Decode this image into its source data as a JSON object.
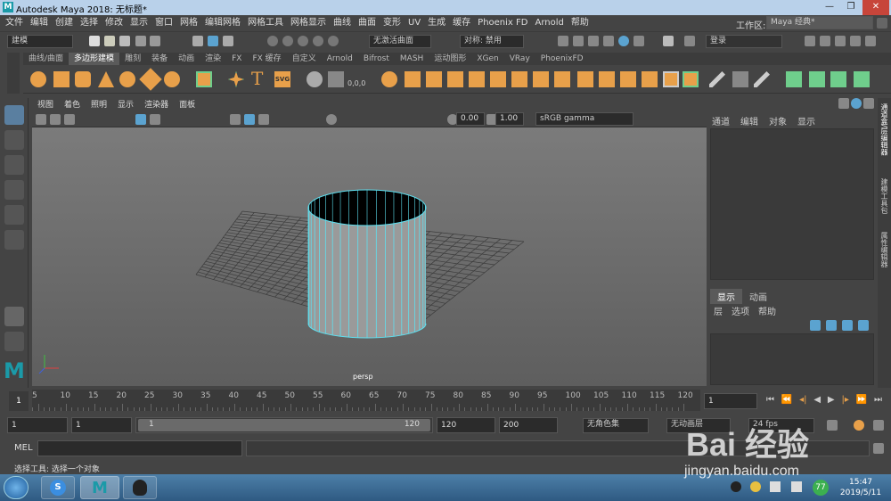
{
  "window": {
    "title": "Autodesk Maya 2018: 无标题*",
    "minimize": "—",
    "restore": "❐",
    "close": "✕"
  },
  "menu": [
    "文件",
    "编辑",
    "创建",
    "选择",
    "修改",
    "显示",
    "窗口",
    "网格",
    "编辑网格",
    "网格工具",
    "网格显示",
    "曲线",
    "曲面",
    "变形",
    "UV",
    "生成",
    "缓存",
    "Phoenix FD",
    "Arnold",
    "帮助"
  ],
  "workspace": {
    "label": "工作区:",
    "value": "Maya 经典*"
  },
  "statusline": {
    "mode": "建模",
    "live_surface": "无激活曲面",
    "symmetry": "对称: 禁用",
    "login": "登录"
  },
  "shelf_tabs": [
    "曲线/曲面",
    "多边形建模",
    "雕刻",
    "装备",
    "动画",
    "渲染",
    "FX",
    "FX 缓存",
    "自定义",
    "Arnold",
    "Bifrost",
    "MASH",
    "运动图形",
    "XGen",
    "VRay",
    "PhoenixFD"
  ],
  "shelf_active": "多边形建模",
  "viewport_menu": [
    "视图",
    "着色",
    "照明",
    "显示",
    "渲染器",
    "面板"
  ],
  "viewport_tools": {
    "exposure": "0.00",
    "gamma": "1.00",
    "colorspace": "sRGB gamma"
  },
  "viewport_label": "persp",
  "channel_box": {
    "menu": [
      "通道",
      "编辑",
      "对象",
      "显示"
    ]
  },
  "layer_editor": {
    "tabs": [
      "显示",
      "动画"
    ],
    "menu": [
      "层",
      "选项",
      "帮助"
    ]
  },
  "side_tabs": [
    "通道盒/层编辑器",
    "建模工具包",
    "属性编辑器"
  ],
  "timeline": {
    "ticks": [
      "5",
      "10",
      "15",
      "20",
      "25",
      "30",
      "35",
      "40",
      "45",
      "50",
      "55",
      "60",
      "65",
      "70",
      "75",
      "80",
      "85",
      "90",
      "95",
      "100",
      "105",
      "110",
      "115",
      "120"
    ],
    "current": "1",
    "left_marker": "1"
  },
  "range": {
    "start": "1",
    "anim_start": "1",
    "slider_start": "1",
    "slider_end": "120",
    "end": "120",
    "anim_end": "200",
    "character_set": "无角色集",
    "anim_layer": "无动画层",
    "fps": "24 fps"
  },
  "cmdline": {
    "label": "MEL"
  },
  "helpline": {
    "text": "选择工具: 选择一个对象"
  },
  "taskbar": {
    "time": "15:47",
    "date": "2019/5/11",
    "badge": "77"
  },
  "watermark": {
    "text": "Bai 经验",
    "url": "jingyan.baidu.com"
  },
  "colors": {
    "accent": "#5ba3d0",
    "shelf_orange": "#e8a04a",
    "shelf_green": "#6fce8c",
    "selected_wire": "#5ee0f0"
  }
}
